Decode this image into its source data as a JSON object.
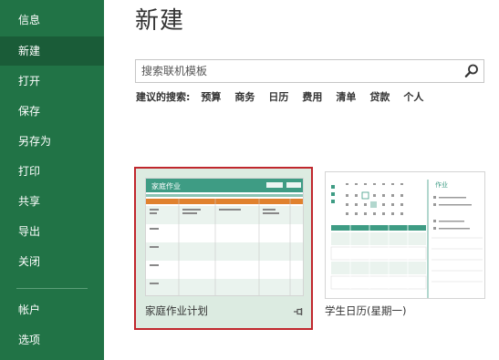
{
  "sidebar": {
    "items": [
      {
        "label": "信息"
      },
      {
        "label": "新建"
      },
      {
        "label": "打开"
      },
      {
        "label": "保存"
      },
      {
        "label": "另存为"
      },
      {
        "label": "打印"
      },
      {
        "label": "共享"
      },
      {
        "label": "导出"
      },
      {
        "label": "关闭"
      },
      {
        "label": "帐户"
      },
      {
        "label": "选项"
      }
    ]
  },
  "main": {
    "title": "新建",
    "search": {
      "placeholder": "搜索联机模板",
      "value": ""
    },
    "suggested": {
      "label": "建议的搜索:",
      "links": [
        "预算",
        "商务",
        "日历",
        "费用",
        "清单",
        "贷款",
        "个人"
      ]
    },
    "templates": [
      {
        "caption": "家庭作业计划",
        "thumb_title": "家庭作业",
        "selected": true
      },
      {
        "caption": "学生日历(星期一)",
        "thumb_heading": "作业",
        "selected": false
      }
    ]
  },
  "colors": {
    "sidebar": "#217346",
    "sidebar_active": "#1a5c38",
    "selection_border": "#c0272d",
    "card_selected_bg": "#dcebe1",
    "thumb_header": "#3e9c84",
    "thumb_orange": "#e0812e"
  }
}
